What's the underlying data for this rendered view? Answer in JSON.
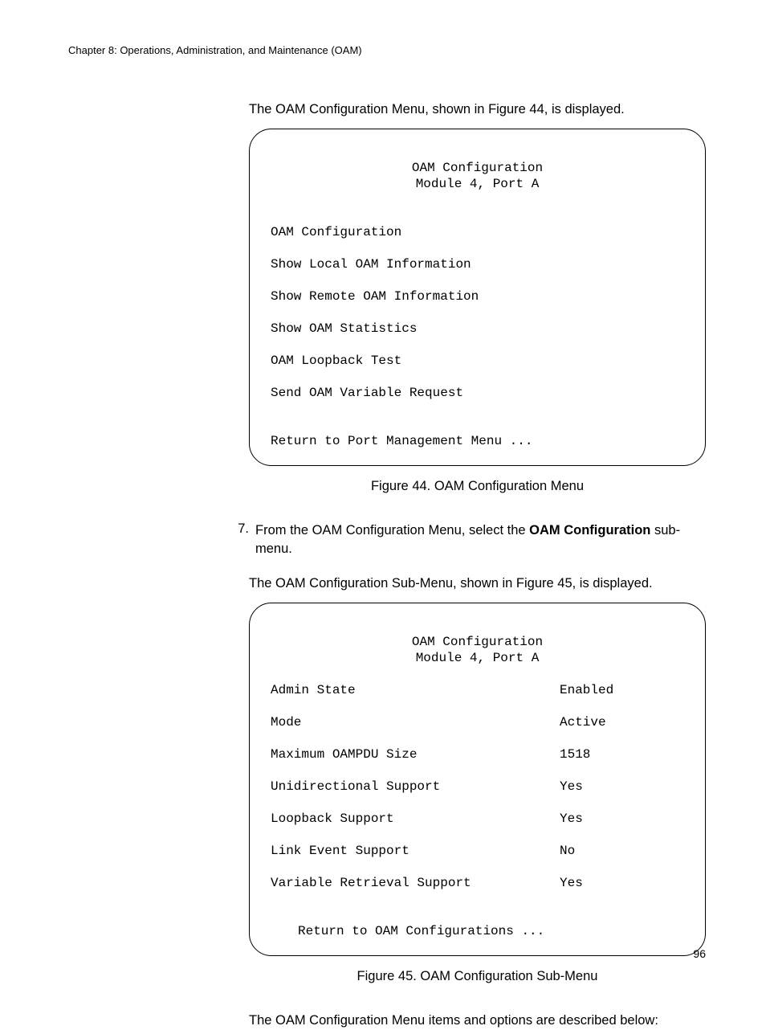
{
  "chapter_header": "Chapter 8: Operations, Administration, and Maintenance (OAM)",
  "intro_text_1": "The OAM Configuration Menu, shown in Figure 44, is displayed.",
  "figure44": {
    "title": "OAM Configuration",
    "subtitle": "Module 4, Port A",
    "items": [
      "OAM Configuration",
      "Show Local OAM Information",
      "Show Remote OAM Information",
      "Show OAM Statistics",
      "OAM Loopback Test",
      "Send OAM Variable Request"
    ],
    "return_text": "Return to Port Management Menu ...",
    "caption": "Figure 44. OAM Configuration Menu"
  },
  "step7": {
    "num": "7.",
    "text_prefix": "From the OAM Configuration Menu, select the ",
    "text_bold": "OAM Configuration",
    "text_suffix": " sub-menu."
  },
  "intro_text_2": "The OAM Configuration Sub-Menu, shown in Figure 45, is displayed.",
  "figure45": {
    "title": "OAM Configuration",
    "subtitle": "Module 4, Port A",
    "rows": [
      {
        "label": "Admin State",
        "value": "Enabled"
      },
      {
        "label": "Mode",
        "value": "Active"
      },
      {
        "label": "Maximum OAMPDU Size",
        "value": "1518"
      },
      {
        "label": "Unidirectional Support",
        "value": "Yes"
      },
      {
        "label": "Loopback Support",
        "value": "Yes"
      },
      {
        "label": "Link Event Support",
        "value": "No"
      },
      {
        "label": "Variable Retrieval Support",
        "value": "Yes"
      }
    ],
    "return_text": "Return to OAM Configurations ...",
    "caption": "Figure 45. OAM Configuration Sub-Menu"
  },
  "outro_text": "The OAM Configuration Menu items and options are described below:",
  "page_number": "96"
}
